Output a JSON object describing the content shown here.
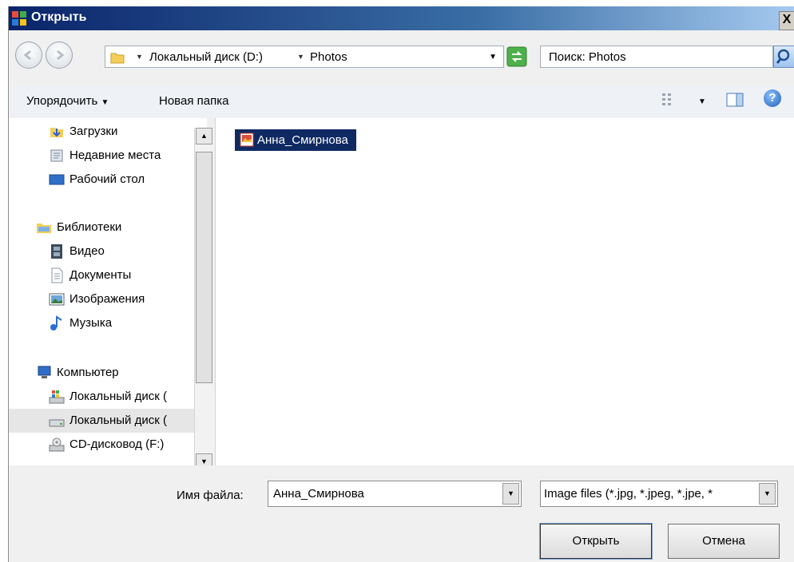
{
  "window": {
    "title": "Открыть",
    "close_label": "X"
  },
  "address": {
    "crumbs": [
      "Локальный диск (D:)",
      "Photos"
    ]
  },
  "search": {
    "placeholder": "Поиск: Photos"
  },
  "toolbar": {
    "organize_label": "Упорядочить",
    "new_folder_label": "Новая папка"
  },
  "sidebar": {
    "items": [
      {
        "label": "Загрузки",
        "icon": "downloads-icon"
      },
      {
        "label": "Недавние места",
        "icon": "recent-places-icon"
      },
      {
        "label": "Рабочий стол",
        "icon": "desktop-icon"
      },
      {
        "label": "Библиотеки",
        "icon": "libraries-icon"
      },
      {
        "label": "Видео",
        "icon": "video-icon"
      },
      {
        "label": "Документы",
        "icon": "documents-icon"
      },
      {
        "label": "Изображения",
        "icon": "pictures-icon"
      },
      {
        "label": "Музыка",
        "icon": "music-icon"
      },
      {
        "label": "Компьютер",
        "icon": "computer-icon"
      },
      {
        "label": "Локальный диск (",
        "icon": "system-drive-icon"
      },
      {
        "label": "Локальный диск (",
        "icon": "drive-icon",
        "selected": true
      },
      {
        "label": "CD-дисковод (F:)",
        "icon": "cd-drive-icon"
      }
    ]
  },
  "files": [
    {
      "name": "Анна_Смирнова",
      "icon": "image-file-icon",
      "selected": true
    }
  ],
  "bottom": {
    "filename_label": "Имя файла:",
    "filename_value": "Анна_Смирнова",
    "filter_value": "Image files (*.jpg, *.jpeg, *.jpe, *",
    "open_label": "Открыть",
    "cancel_label": "Отмена"
  },
  "colors": {
    "selection": "#0f2a62",
    "titlebar": "#0a246a"
  }
}
